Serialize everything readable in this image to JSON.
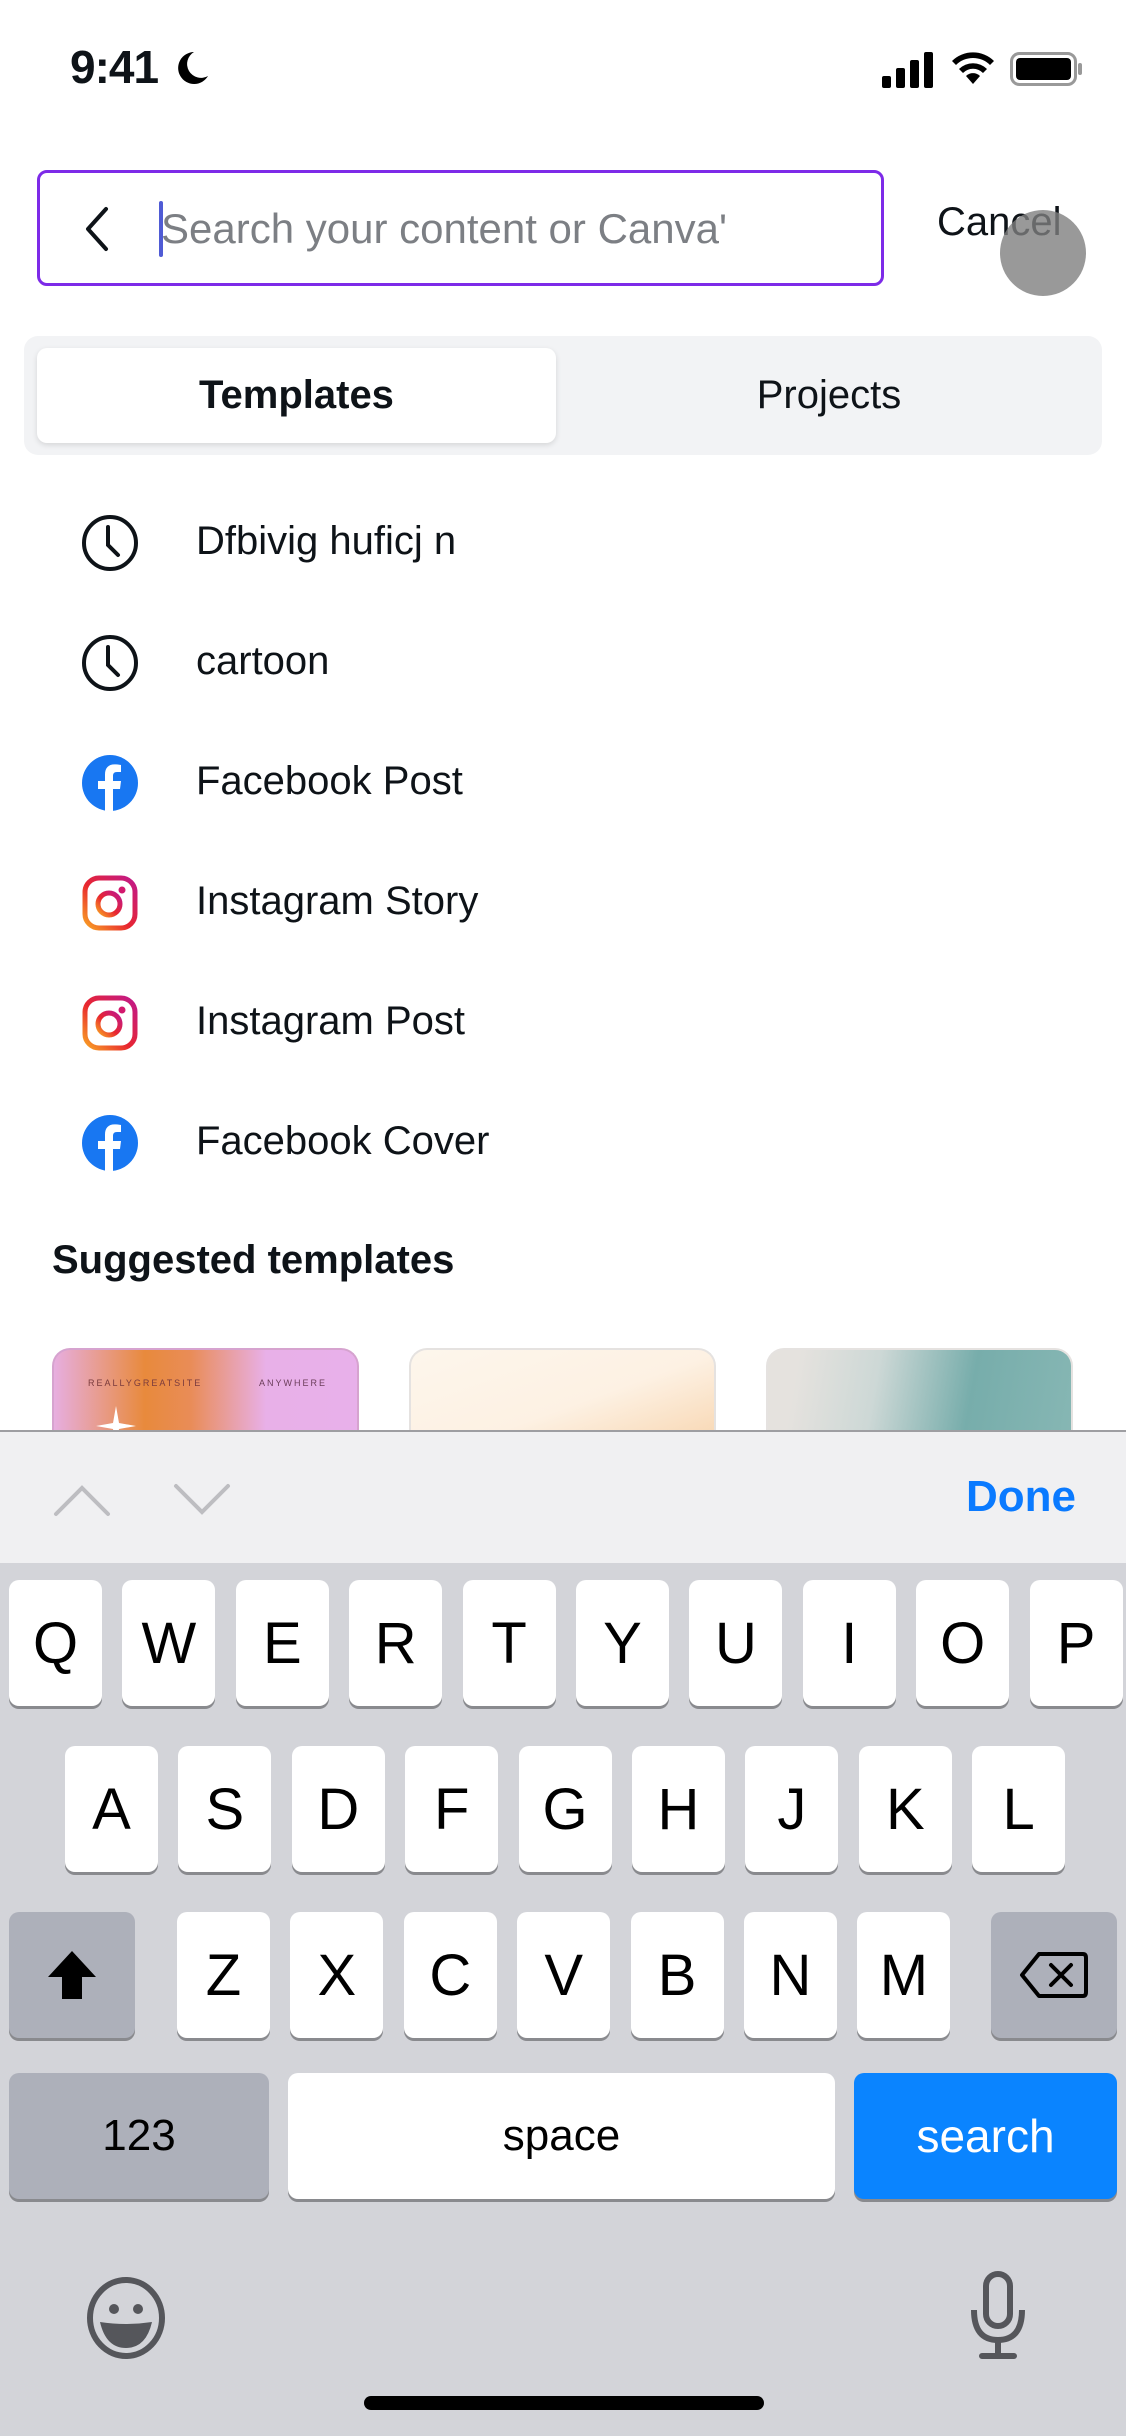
{
  "status_bar": {
    "time": "9:41",
    "icons": [
      "moon-icon",
      "signal-icon",
      "wifi-icon",
      "battery-icon"
    ]
  },
  "search": {
    "placeholder": "Search your content or Canva'",
    "value": "",
    "cancel_label": "Cancel",
    "border_color": "#7d2ae8"
  },
  "tabs": [
    {
      "label": "Templates",
      "selected": true
    },
    {
      "label": "Projects",
      "selected": false
    }
  ],
  "suggestions": [
    {
      "icon": "clock-icon",
      "label": "Dfbivig huficj n"
    },
    {
      "icon": "clock-icon",
      "label": "cartoon"
    },
    {
      "icon": "facebook-icon",
      "label": "Facebook Post"
    },
    {
      "icon": "instagram-icon",
      "label": "Instagram Story"
    },
    {
      "icon": "instagram-icon",
      "label": "Instagram Post"
    },
    {
      "icon": "facebook-icon",
      "label": "Facebook Cover"
    }
  ],
  "suggested_templates": {
    "title": "Suggested templates",
    "cards": [
      {
        "text_left": "REALLYGREATSITE",
        "text_right": "ANYWHERE"
      },
      {},
      {}
    ]
  },
  "accessory_bar": {
    "done_label": "Done",
    "done_color": "#0a7aff"
  },
  "keyboard": {
    "row1": [
      "Q",
      "W",
      "E",
      "R",
      "T",
      "Y",
      "U",
      "I",
      "O",
      "P"
    ],
    "row2": [
      "A",
      "S",
      "D",
      "F",
      "G",
      "H",
      "J",
      "K",
      "L"
    ],
    "row3": [
      "Z",
      "X",
      "C",
      "V",
      "B",
      "N",
      "M"
    ],
    "numbers_label": "123",
    "space_label": "space",
    "search_label": "search",
    "search_color": "#0a84ff"
  }
}
